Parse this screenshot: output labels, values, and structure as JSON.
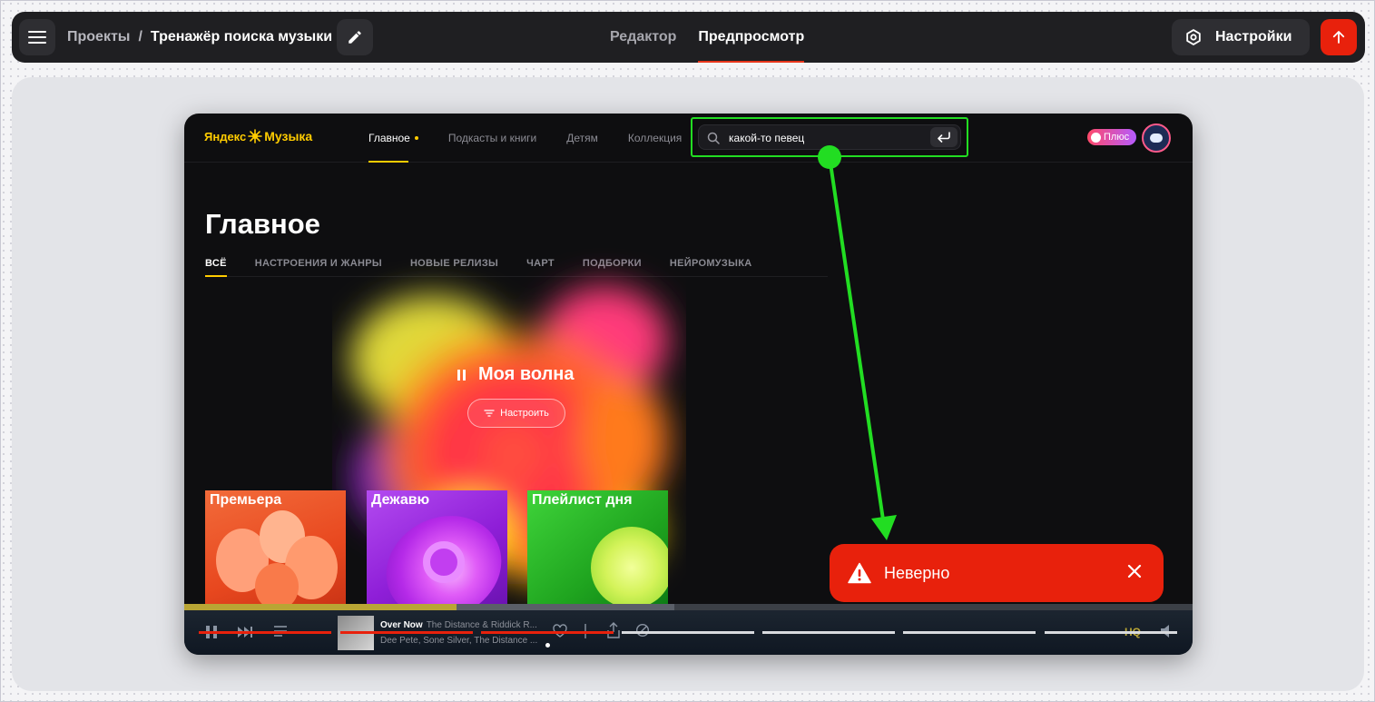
{
  "topbar": {
    "breadcrumb_root": "Проекты",
    "breadcrumb_sep": "/",
    "project_name": "Тренажёр поиска музыки",
    "tabs": [
      {
        "label": "Редактор",
        "active": false
      },
      {
        "label": "Предпросмотр",
        "active": true
      }
    ],
    "settings_label": "Настройки",
    "icons": {
      "menu": "hamburger-icon",
      "edit": "pencil-icon",
      "settings": "settings-icon",
      "publish": "arrow-up-icon"
    },
    "accent_color": "#e8210c"
  },
  "preview": {
    "logo": {
      "left": "Яндекс",
      "right": "Музыка"
    },
    "nav": [
      "Главное",
      "Подкасты и книги",
      "Детям",
      "Коллекция"
    ],
    "search_value": "какой-то певец",
    "plus_label": "Плюс",
    "page_title": "Главное",
    "categories": [
      "ВСЁ",
      "НАСТРОЕНИЯ И ЖАНРЫ",
      "НОВЫЕ РЕЛИЗЫ",
      "ЧАРТ",
      "ПОДБОРКИ",
      "НЕЙРОМУЗЫКА"
    ],
    "wave_title": "Моя волна",
    "tune_label": "Настроить",
    "cards": [
      "Премьера",
      "Дежавю",
      "Плейлист дня"
    ],
    "player": {
      "track_title": "Over Now",
      "track_subtitle": "The Distance & Riddick R...",
      "artists": "Dee Pete, Sone Silver, The Distance ...",
      "quality_label": "HQ",
      "progress": 0.27
    }
  },
  "toast": {
    "text": "Неверно",
    "color": "#e8210c",
    "icons": {
      "warning": "warning-icon",
      "close": "close-icon"
    }
  },
  "highlight_color": "#22dd22"
}
